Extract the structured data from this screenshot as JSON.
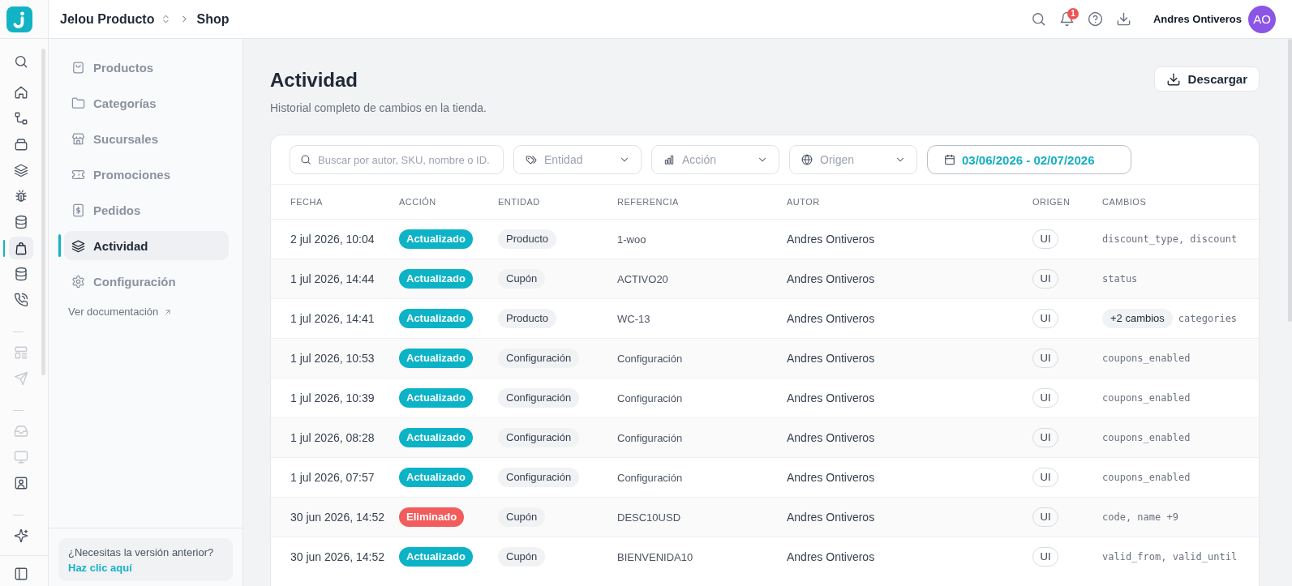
{
  "rail": {
    "groups": [
      [
        {
          "selected": false,
          "disabled": false
        },
        {
          "selected": false,
          "disabled": false
        },
        {
          "selected": false,
          "disabled": false
        },
        {
          "selected": false,
          "disabled": false
        },
        {
          "selected": false,
          "disabled": false
        },
        {
          "selected": false,
          "disabled": false
        },
        {
          "selected": true,
          "disabled": false
        },
        {
          "selected": false,
          "disabled": false
        },
        {
          "selected": false,
          "disabled": false
        }
      ],
      [
        {
          "selected": false,
          "disabled": true
        },
        {
          "selected": false,
          "disabled": true
        }
      ],
      [
        {
          "selected": false,
          "disabled": true
        },
        {
          "selected": false,
          "disabled": true
        },
        {
          "selected": false,
          "disabled": false
        }
      ],
      [
        {
          "selected": false,
          "disabled": false
        }
      ]
    ]
  },
  "topbar": {
    "workspace": "Jelou Producto",
    "page": "Shop",
    "notifications": "1",
    "user_name": "Andres Ontiveros",
    "user_initials": "AO"
  },
  "sidebar": {
    "items": [
      {
        "label": "Productos",
        "selected": false
      },
      {
        "label": "Categorías",
        "selected": false
      },
      {
        "label": "Sucursales",
        "selected": false
      },
      {
        "label": "Promociones",
        "selected": false
      },
      {
        "label": "Pedidos",
        "selected": false
      },
      {
        "label": "Actividad",
        "selected": true
      },
      {
        "label": "Configuración",
        "selected": false
      }
    ],
    "docs_link": "Ver documentación",
    "legacy_prompt": "¿Necesitas la versión anterior?",
    "legacy_link": "Haz clic aquí"
  },
  "page": {
    "title": "Actividad",
    "subtitle": "Historial completo de cambios en la tienda.",
    "download_button": "Descargar"
  },
  "filters": {
    "search": {
      "placeholder": "Buscar por autor, SKU, nombre o ID."
    },
    "dropdowns": [
      {
        "placeholder": "Entidad"
      },
      {
        "placeholder": "Acción"
      },
      {
        "placeholder": "Origen"
      }
    ],
    "date_range": {
      "value": "03/06/2026 - 02/07/2026"
    }
  },
  "table": {
    "columns": [
      "FECHA",
      "ACCIÓN",
      "ENTIDAD",
      "REFERENCIA",
      "AUTOR",
      "ORIGEN",
      "CAMBIOS"
    ],
    "rows": [
      {
        "date": "2 jul 2026, 10:04",
        "action": {
          "label": "Actualizado",
          "color": "#0cb3c6"
        },
        "entity": "Producto",
        "reference": "1-woo",
        "author": "Andres Ontiveros",
        "origin": "UI",
        "changes": {
          "fields": "discount_type, discount"
        }
      },
      {
        "date": "1 jul 2026, 14:44",
        "action": {
          "label": "Actualizado",
          "color": "#0cb3c6"
        },
        "entity": "Cupón",
        "reference": "ACTIVO20",
        "author": "Andres Ontiveros",
        "origin": "UI",
        "changes": {
          "fields": "status"
        }
      },
      {
        "date": "1 jul 2026, 14:41",
        "action": {
          "label": "Actualizado",
          "color": "#0cb3c6"
        },
        "entity": "Producto",
        "reference": "WC-13",
        "author": "Andres Ontiveros",
        "origin": "UI",
        "changes": {
          "extra": "+2 cambios",
          "fields": "categories"
        }
      },
      {
        "date": "1 jul 2026, 10:53",
        "action": {
          "label": "Actualizado",
          "color": "#0cb3c6"
        },
        "entity": "Configuración",
        "reference": "Configuración",
        "author": "Andres Ontiveros",
        "origin": "UI",
        "changes": {
          "fields": "coupons_enabled"
        }
      },
      {
        "date": "1 jul 2026, 10:39",
        "action": {
          "label": "Actualizado",
          "color": "#0cb3c6"
        },
        "entity": "Configuración",
        "reference": "Configuración",
        "author": "Andres Ontiveros",
        "origin": "UI",
        "changes": {
          "fields": "coupons_enabled"
        }
      },
      {
        "date": "1 jul 2026, 08:28",
        "action": {
          "label": "Actualizado",
          "color": "#0cb3c6"
        },
        "entity": "Configuración",
        "reference": "Configuración",
        "author": "Andres Ontiveros",
        "origin": "UI",
        "changes": {
          "fields": "coupons_enabled"
        }
      },
      {
        "date": "1 jul 2026, 07:57",
        "action": {
          "label": "Actualizado",
          "color": "#0cb3c6"
        },
        "entity": "Configuración",
        "reference": "Configuración",
        "author": "Andres Ontiveros",
        "origin": "UI",
        "changes": {
          "fields": "coupons_enabled"
        }
      },
      {
        "date": "30 jun 2026, 14:52",
        "action": {
          "label": "Eliminado",
          "color": "#f25c5c"
        },
        "entity": "Cupón",
        "reference": "DESC10USD",
        "author": "Andres Ontiveros",
        "origin": "UI",
        "changes": {
          "fields": "code, name +9"
        }
      },
      {
        "date": "30 jun 2026, 14:52",
        "action": {
          "label": "Actualizado",
          "color": "#0cb3c6"
        },
        "entity": "Cupón",
        "reference": "BIENVENIDA10",
        "author": "Andres Ontiveros",
        "origin": "UI",
        "changes": {
          "fields": "valid_from, valid_until"
        }
      }
    ]
  }
}
